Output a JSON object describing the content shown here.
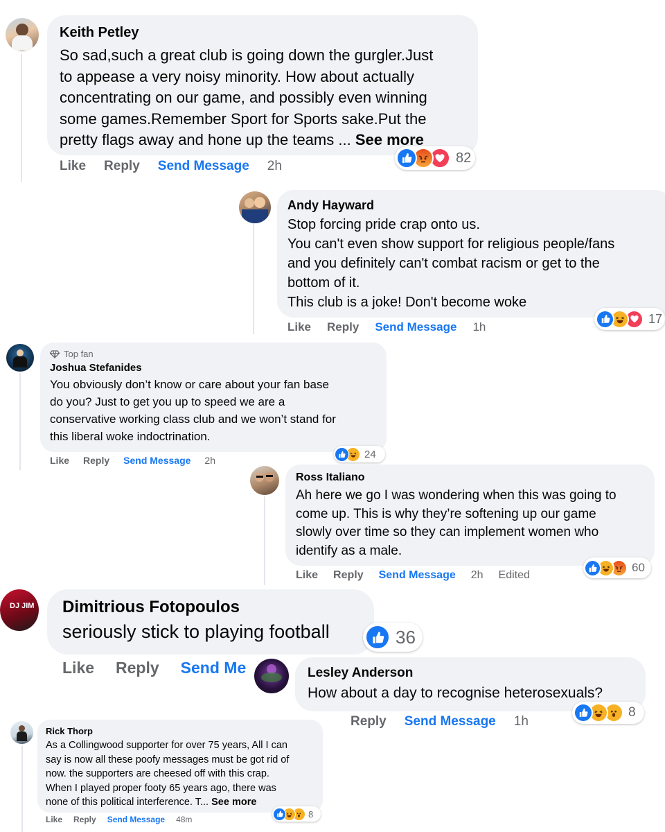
{
  "colors": {
    "like": "#1877f2",
    "angry": "#f35d2b",
    "love": "#f33e58",
    "haha": "#f7b125",
    "bubble": "#f0f2f5",
    "meta": "#65676b"
  },
  "comments": [
    {
      "author": "Keith Petley",
      "text": "So sad,such a great club is going down the gurgler.Just\nto appease a very noisy minority. How about actually\nconcentrating on our game, and possibly even winning\nsome games.Remember Sport for Sports sake.Put the\npretty flags away and hone up the teams ... ",
      "see_more": "See more",
      "actions": {
        "like": "Like",
        "reply": "Reply",
        "send": "Send Message",
        "time": "2h"
      },
      "reactions": [
        "like",
        "angry",
        "love"
      ],
      "reaction_count": "82"
    },
    {
      "author": "Andy Hayward",
      "text": "Stop forcing pride crap onto us.\nYou can't even show support for religious people/fans\nand you definitely can't combat racism or get to the\nbottom of it.\nThis club is a joke! Don't become woke",
      "actions": {
        "like": "Like",
        "reply": "Reply",
        "send": "Send Message",
        "time": "1h"
      },
      "reactions": [
        "like",
        "haha",
        "love"
      ],
      "reaction_count": "17"
    },
    {
      "badge": "Top fan",
      "author": "Joshua Stefanides",
      "text": "You obviously don’t know or care about your fan base\ndo you? Just to get you up to speed we are a\nconservative working class club and we won’t stand for\nthis liberal woke indoctrination.",
      "actions": {
        "like": "Like",
        "reply": "Reply",
        "send": "Send Message",
        "time": "2h"
      },
      "reactions": [
        "like",
        "haha"
      ],
      "reaction_count": "24"
    },
    {
      "author": "Ross Italiano",
      "text": "Ah here we go I was wondering when this was going to\ncome up. This is why they’re softening up our game\nslowly over time so they can implement women who\nidentify as a male.",
      "actions": {
        "like": "Like",
        "reply": "Reply",
        "send": "Send Message",
        "time": "2h",
        "edited": "Edited"
      },
      "reactions": [
        "like",
        "haha",
        "angry"
      ],
      "reaction_count": "60"
    },
    {
      "author": "Dimitrious Fotopoulos",
      "avatar_text": "DJ JIM",
      "text": "seriously stick to playing football",
      "actions": {
        "like": "Like",
        "reply": "Reply",
        "send": "Send Me"
      },
      "reactions": [
        "like"
      ],
      "reaction_count": "36"
    },
    {
      "author": "Lesley Anderson",
      "text": "How about a day to recognise heterosexuals?",
      "actions": {
        "reply": "Reply",
        "send": "Send Message",
        "time": "1h"
      },
      "reactions": [
        "like",
        "haha",
        "wow"
      ],
      "reaction_count": "8"
    },
    {
      "author": "Rick Thorp",
      "text": "As a Collingwood supporter for over 75 years, All I can\nsay is now all these poofy messages must be got rid of\nnow. the supporters are cheesed off with this crap.\nWhen I played proper footy 65 years ago, there was\nnone of this political interference. T... ",
      "see_more": "See more",
      "actions": {
        "like": "Like",
        "reply": "Reply",
        "send": "Send Message",
        "time": "48m"
      },
      "reactions": [
        "like",
        "haha",
        "wow"
      ],
      "reaction_count": "8"
    }
  ]
}
